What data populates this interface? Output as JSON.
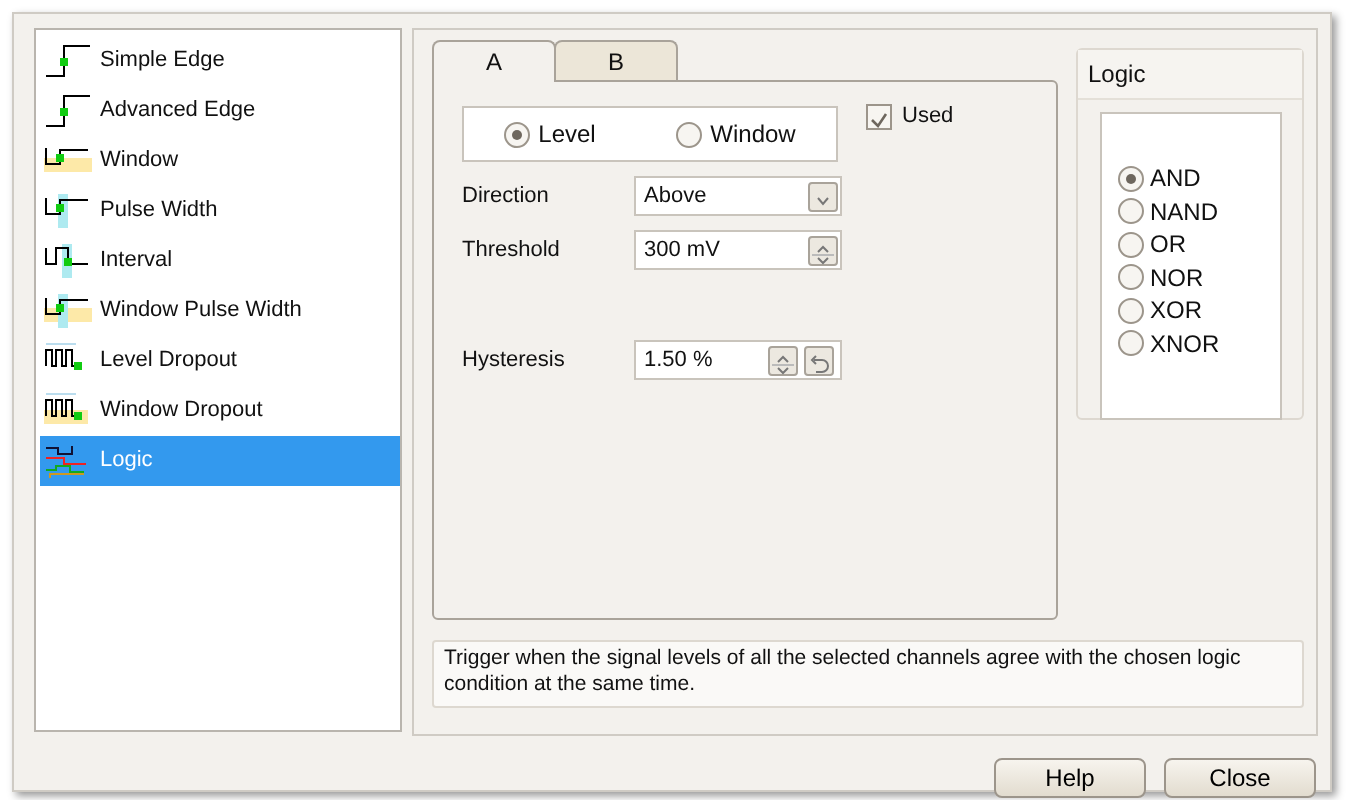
{
  "trigger_types": [
    {
      "label": "Simple Edge",
      "kind": "edge",
      "selected": false
    },
    {
      "label": "Advanced Edge",
      "kind": "edge",
      "selected": false
    },
    {
      "label": "Window",
      "kind": "window",
      "selected": false
    },
    {
      "label": "Pulse Width",
      "kind": "pulse",
      "selected": false
    },
    {
      "label": "Interval",
      "kind": "interval",
      "selected": false
    },
    {
      "label": "Window Pulse Width",
      "kind": "window-pulse",
      "selected": false
    },
    {
      "label": "Level Dropout",
      "kind": "dropout",
      "selected": false
    },
    {
      "label": "Window Dropout",
      "kind": "window-dropout",
      "selected": false
    },
    {
      "label": "Logic",
      "kind": "logic",
      "selected": true
    }
  ],
  "tabs": [
    {
      "label": "A",
      "selected": true
    },
    {
      "label": "B",
      "selected": false
    }
  ],
  "mode_options": [
    {
      "label": "Level",
      "selected": true
    },
    {
      "label": "Window",
      "selected": false
    }
  ],
  "used": {
    "label": "Used",
    "checked": true
  },
  "fields": [
    {
      "label": "Direction",
      "kind": "dropdown",
      "value": "Above"
    },
    {
      "label": "Threshold",
      "kind": "spin",
      "value": "300 mV"
    },
    {
      "label": "Hysteresis",
      "kind": "spin-reset",
      "value": "1.50 %"
    }
  ],
  "logic": {
    "title": "Logic",
    "options": [
      {
        "label": "AND",
        "selected": true
      },
      {
        "label": "NAND",
        "selected": false
      },
      {
        "label": "OR",
        "selected": false
      },
      {
        "label": "NOR",
        "selected": false
      },
      {
        "label": "XOR",
        "selected": false
      },
      {
        "label": "XNOR",
        "selected": false
      }
    ]
  },
  "description": "Trigger when the signal levels of all the selected channels agree with the chosen logic condition at the same time.",
  "buttons": [
    "Help",
    "Close"
  ]
}
